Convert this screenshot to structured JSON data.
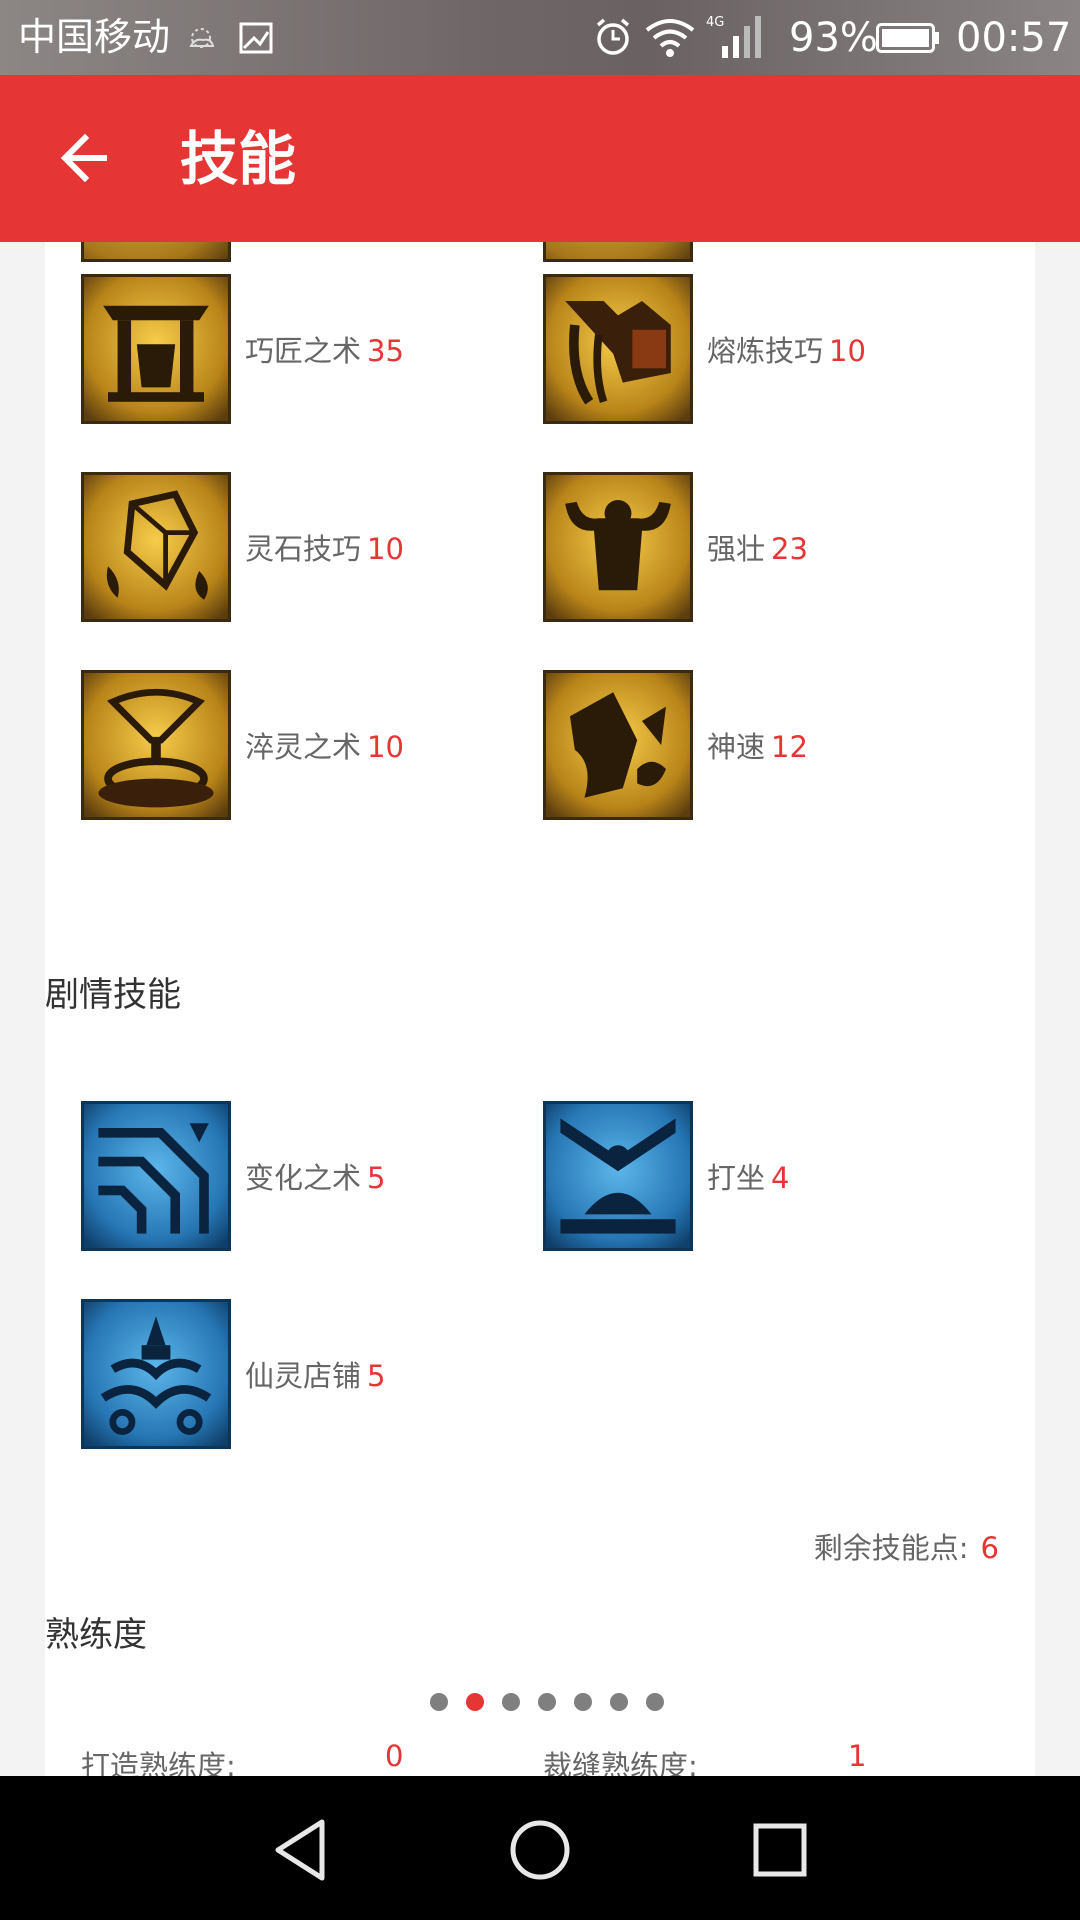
{
  "status_bar": {
    "carrier": "中国移动",
    "network": "4G",
    "battery_percent": "93%",
    "time": "00:57"
  },
  "app_bar": {
    "title": "技能",
    "back_icon": "arrow-left-icon"
  },
  "life_skills": [
    {
      "name": "巧匠之术",
      "level": "35",
      "icon": "craftsman-icon"
    },
    {
      "name": "熔炼技巧",
      "level": "10",
      "icon": "smelting-icon"
    },
    {
      "name": "灵石技巧",
      "level": "10",
      "icon": "spirit-stone-icon"
    },
    {
      "name": "强壮",
      "level": "23",
      "icon": "strength-icon"
    },
    {
      "name": "淬灵之术",
      "level": "10",
      "icon": "quench-icon"
    },
    {
      "name": "神速",
      "level": "12",
      "icon": "swift-icon"
    }
  ],
  "story_section": {
    "title": "剧情技能",
    "skills": [
      {
        "name": "变化之术",
        "level": "5",
        "icon": "transform-icon"
      },
      {
        "name": "打坐",
        "level": "4",
        "icon": "meditate-icon"
      },
      {
        "name": "仙灵店铺",
        "level": "5",
        "icon": "shop-icon"
      }
    ],
    "remaining_label": "剩余技能点:",
    "remaining_value": "6"
  },
  "proficiency": {
    "title": "熟练度",
    "page_count": 7,
    "active_page": 2,
    "items": [
      {
        "label": "打造熟练度:",
        "value": "0"
      },
      {
        "label": "裁缝熟练度:",
        "value": "1"
      }
    ]
  },
  "colors": {
    "accent": "#e53535",
    "icon_gold": "#d9a62a",
    "icon_blue": "#2f86c8"
  },
  "nav_bar": {
    "icons": [
      "back-triangle-icon",
      "home-circle-icon",
      "recents-square-icon"
    ]
  }
}
